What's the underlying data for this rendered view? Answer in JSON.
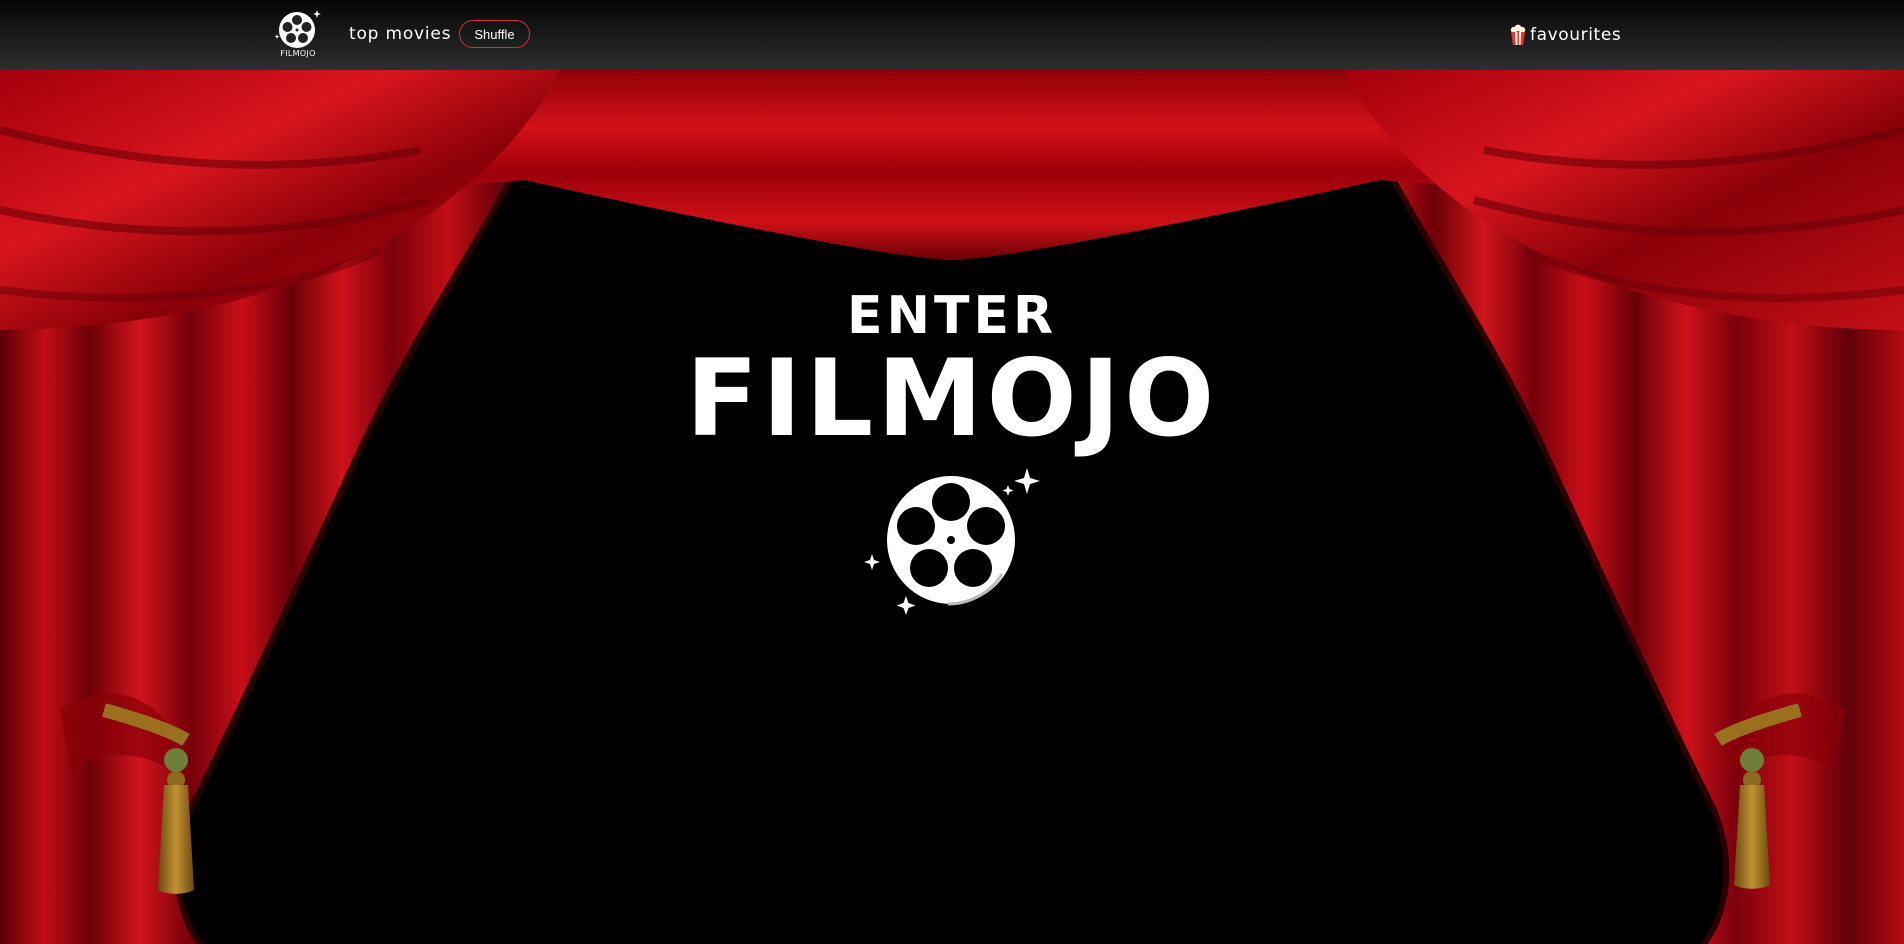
{
  "nav": {
    "logo_text": "FILMOJO",
    "logo_icon": "film-reel-icon",
    "top_movies_label": "top movies",
    "shuffle_label": "Shuffle",
    "favourites_label": "favourites",
    "favourites_icon": "popcorn-icon",
    "shuffle_border_color": "#d6303a"
  },
  "hero": {
    "subtitle": "ENTER",
    "title": "FILMOJO",
    "icon": "film-reel-icon"
  },
  "colors": {
    "curtain_red": "#b80a12",
    "tassel_gold": "#a87a22",
    "stage_background": "#000000"
  }
}
